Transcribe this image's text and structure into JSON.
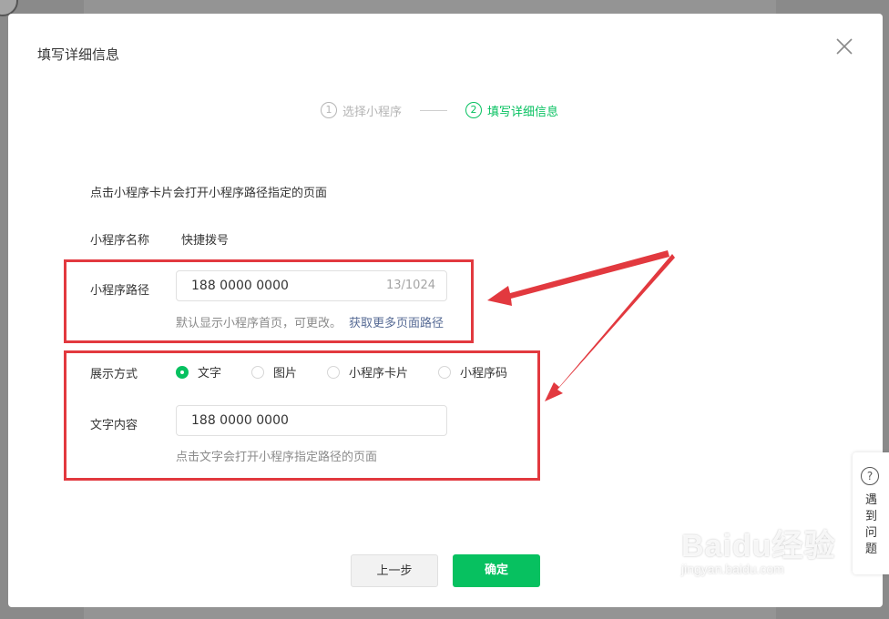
{
  "dialog": {
    "title": "填写详细信息",
    "steps": [
      {
        "num": "1",
        "label": "选择小程序",
        "active": false
      },
      {
        "num": "2",
        "label": "填写详细信息",
        "active": true
      }
    ],
    "description": "点击小程序卡片会打开小程序路径指定的页面",
    "name_row": {
      "label": "小程序名称",
      "value": "快捷拨号"
    },
    "path_row": {
      "label": "小程序路径",
      "input_value": "188 0000 0000",
      "counter": "13/1024",
      "hint": "默认显示小程序首页，可更改。",
      "hint_link": "获取更多页面路径"
    },
    "display_row": {
      "label": "展示方式",
      "options": [
        {
          "label": "文字",
          "checked": true
        },
        {
          "label": "图片",
          "checked": false
        },
        {
          "label": "小程序卡片",
          "checked": false
        },
        {
          "label": "小程序码",
          "checked": false
        }
      ]
    },
    "text_row": {
      "label": "文字内容",
      "input_value": "188 0000 0000",
      "hint": "点击文字会打开小程序指定路径的页面"
    },
    "buttons": {
      "prev": "上一步",
      "confirm": "确定"
    }
  },
  "help_widget": {
    "icon": "question-icon",
    "text": "遇到问题"
  },
  "watermark": {
    "brand": "Baidu经验",
    "sub": "jingyan.baidu.com"
  },
  "colors": {
    "accent": "#07c160",
    "link": "#576b95",
    "annotation": "#e2393f"
  }
}
